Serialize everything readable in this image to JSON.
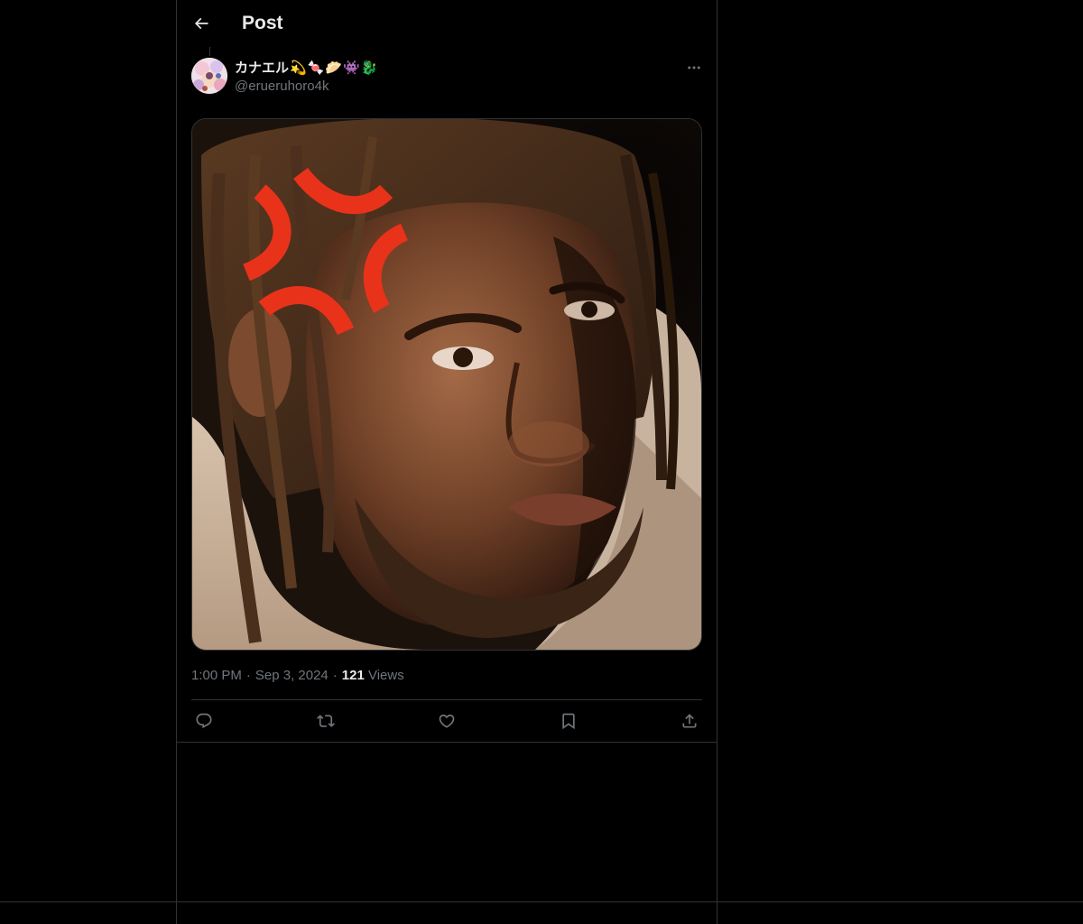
{
  "header": {
    "title": "Post",
    "back_icon": "arrow-left-icon"
  },
  "author": {
    "display_name": "カナエル",
    "name_emojis": [
      "💫",
      "🍬",
      "🥟",
      "👾",
      "🐉"
    ],
    "handle": "@erueruhoro4k",
    "avatar_icon": "avatar-illustration"
  },
  "post": {
    "media_description_icon": "portrait-photo-with-anger-symbol",
    "time": "1:00 PM",
    "date": "Sep 3, 2024",
    "separator": "·",
    "views_count": "121",
    "views_label": "Views"
  },
  "actions": [
    {
      "name": "reply-button",
      "icon": "reply-icon"
    },
    {
      "name": "repost-button",
      "icon": "repost-icon"
    },
    {
      "name": "like-button",
      "icon": "heart-icon"
    },
    {
      "name": "bookmark-button",
      "icon": "bookmark-icon"
    },
    {
      "name": "share-button",
      "icon": "share-icon"
    }
  ],
  "colors": {
    "background": "#000000",
    "text_primary": "#e7e9ea",
    "text_secondary": "#71767b",
    "border": "#2f3336",
    "anger_symbol": "#e8321a"
  }
}
